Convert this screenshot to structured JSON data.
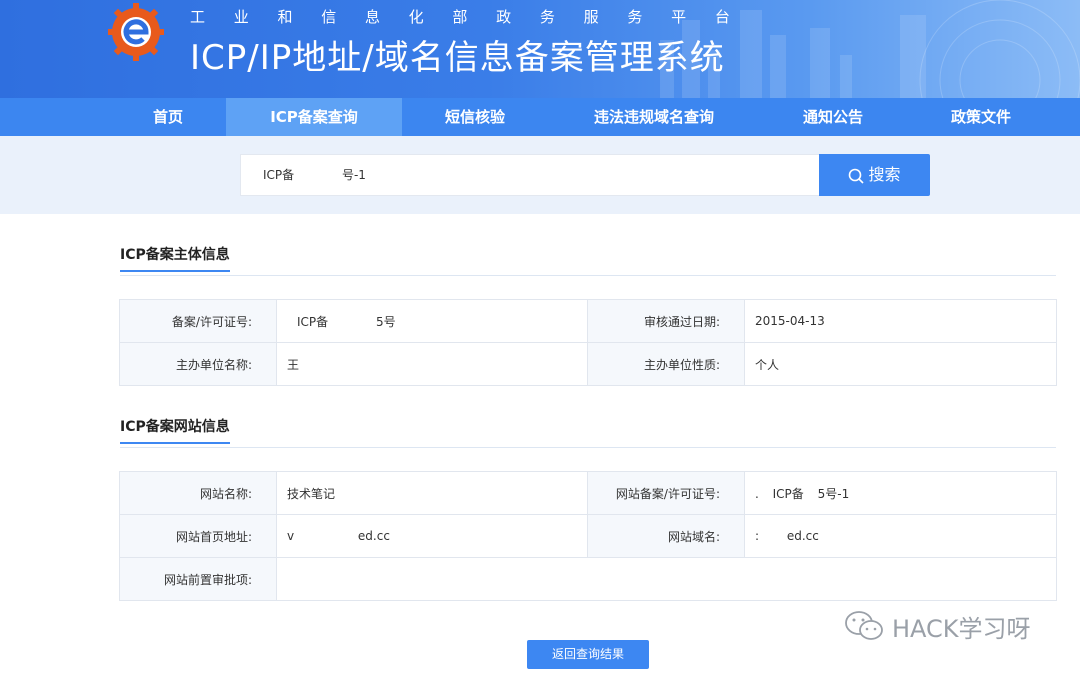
{
  "header": {
    "ministry_chars": [
      "工",
      "业",
      "和",
      "信",
      "息",
      "化",
      "部",
      "政",
      "务",
      "服",
      "务",
      "平",
      "台"
    ],
    "system_title": "ICP/IP地址/域名信息备案管理系统"
  },
  "nav": {
    "items": [
      {
        "label": "首页"
      },
      {
        "label": "ICP备案查询",
        "active": true
      },
      {
        "label": "短信核验"
      },
      {
        "label": "违法违规域名查询"
      },
      {
        "label": "通知公告"
      },
      {
        "label": "政策文件"
      }
    ]
  },
  "search": {
    "value": "ICP备 号-1",
    "button_label": "搜索"
  },
  "subject_section": {
    "title": "ICP备案主体信息",
    "rows": [
      {
        "label1": "备案/许可证号:",
        "value1": "ICP备 5号",
        "label2": "审核通过日期:",
        "value2": "2015-04-13"
      },
      {
        "label1": "主办单位名称:",
        "value1": "王",
        "label2": "主办单位性质:",
        "value2": "个人"
      }
    ]
  },
  "website_section": {
    "title": "ICP备案网站信息",
    "rows": [
      {
        "label1": "网站名称:",
        "value1": "技术笔记",
        "label2": "网站备案/许可证号:",
        "value2": ". ICP备 5号-1"
      },
      {
        "label1": "网站首页地址:",
        "value1": "v ed.cc",
        "label2": "网站域名:",
        "value2": ": ed.cc"
      },
      {
        "label1": "网站前置审批项:",
        "value1": ""
      }
    ]
  },
  "back_button_label": "返回查询结果",
  "watermark": "HACK学习呀",
  "colors": {
    "primary": "#3d87f2",
    "nav": "#3c86f0",
    "search_bg": "#eaf1fb"
  }
}
